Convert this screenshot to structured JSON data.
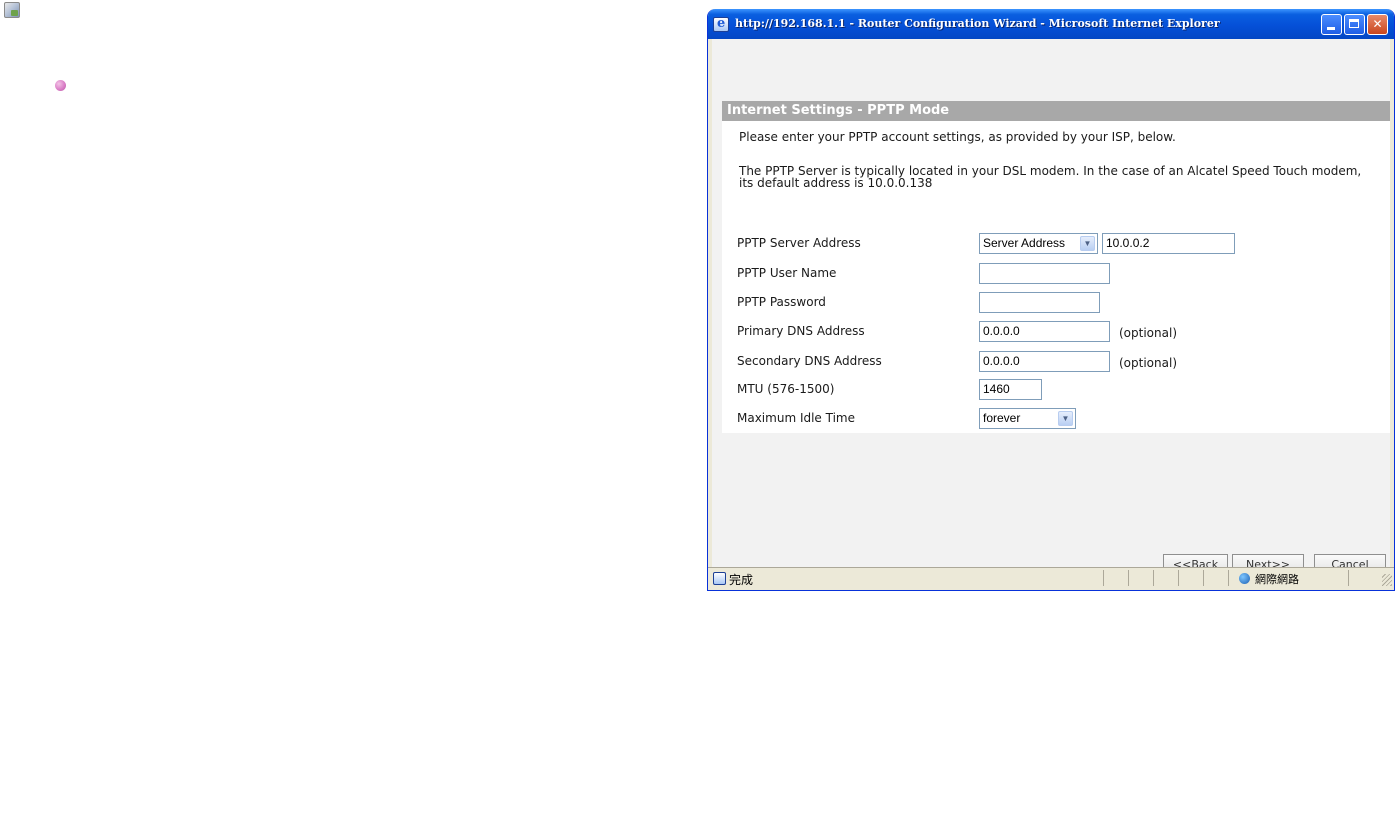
{
  "window": {
    "title": "http://192.168.1.1 - Router Configuration Wizard - Microsoft Internet Explorer",
    "controls": {
      "minimize": "",
      "maximize": "",
      "close": "✕"
    }
  },
  "section": {
    "title": "Internet Settings - PPTP Mode",
    "intro": "Please enter your PPTP account settings, as provided by your ISP, below.",
    "note": "The PPTP Server is typically located in your DSL modem. In the case of an Alcatel Speed Touch modem, its default address is 10.0.0.138"
  },
  "form": {
    "server_address": {
      "label": "PPTP Server Address",
      "mode_selected": "Server Address",
      "value": "10.0.0.2"
    },
    "user_name": {
      "label": "PPTP User Name",
      "value": ""
    },
    "password": {
      "label": "PPTP Password",
      "value": ""
    },
    "primary_dns": {
      "label": "Primary DNS Address",
      "value": "0.0.0.0",
      "hint": "(optional)"
    },
    "secondary_dns": {
      "label": "Secondary DNS Address",
      "value": "0.0.0.0",
      "hint": "(optional)"
    },
    "mtu": {
      "label": "MTU (576-1500)",
      "value": "1460"
    },
    "idle_time": {
      "label": "Maximum Idle Time",
      "selected": "forever"
    }
  },
  "buttons": {
    "back": "<<Back",
    "next": "Next>>",
    "cancel": "Cancel"
  },
  "status": {
    "left": "完成",
    "zone": "網際網路"
  },
  "icons": {
    "page": "page-icon",
    "bullet": "pink-bullet-icon",
    "ie": "ie-icon",
    "dropdown": "chevron-down-icon",
    "zone": "internet-zone-icon"
  }
}
